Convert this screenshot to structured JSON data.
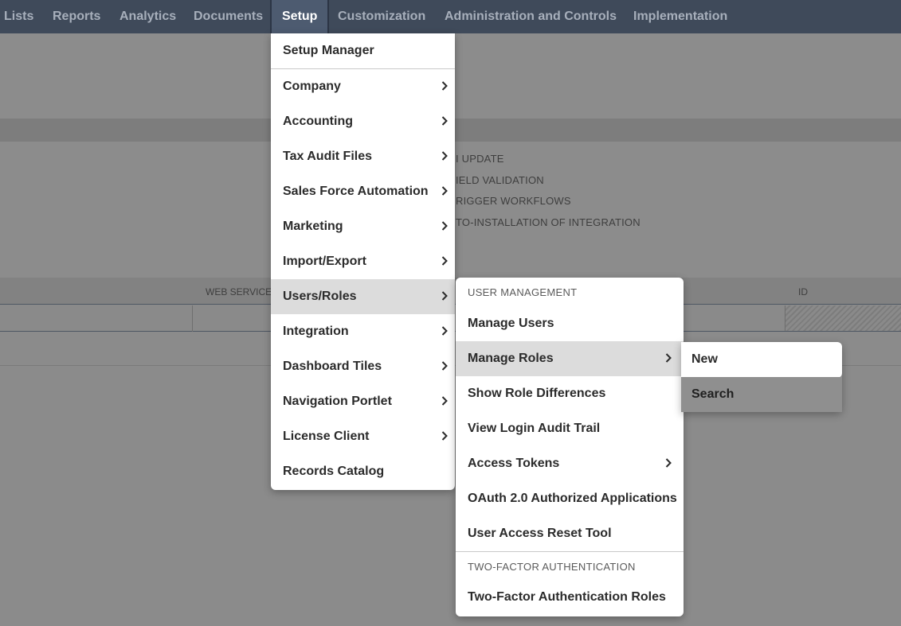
{
  "topnav": {
    "items": [
      "Lists",
      "Reports",
      "Analytics",
      "Documents",
      "Setup",
      "Customization",
      "Administration and Controls",
      "Implementation"
    ],
    "active": "Setup"
  },
  "background": {
    "lines": [
      "I UPDATE",
      "IELD VALIDATION",
      "RIGGER WORKFLOWS",
      "TO-INSTALLATION OF INTEGRATION"
    ],
    "table_headers": [
      "WEB SERVICES",
      "ID"
    ]
  },
  "setup_menu": {
    "items": [
      {
        "label": "Setup Manager",
        "submenu": false
      },
      {
        "label": "Company",
        "submenu": true
      },
      {
        "label": "Accounting",
        "submenu": true
      },
      {
        "label": "Tax Audit Files",
        "submenu": true
      },
      {
        "label": "Sales Force Automation",
        "submenu": true
      },
      {
        "label": "Marketing",
        "submenu": true
      },
      {
        "label": "Import/Export",
        "submenu": true
      },
      {
        "label": "Users/Roles",
        "submenu": true,
        "highlighted": true
      },
      {
        "label": "Integration",
        "submenu": true
      },
      {
        "label": "Dashboard Tiles",
        "submenu": true
      },
      {
        "label": "Navigation Portlet",
        "submenu": true
      },
      {
        "label": "License Client",
        "submenu": true
      },
      {
        "label": "Records Catalog",
        "submenu": false
      }
    ]
  },
  "users_roles_menu": {
    "section1_header": "USER MANAGEMENT",
    "items": [
      {
        "label": "Manage Users",
        "submenu": false
      },
      {
        "label": "Manage Roles",
        "submenu": true,
        "highlighted": true
      },
      {
        "label": "Show Role Differences",
        "submenu": false
      },
      {
        "label": "View Login Audit Trail",
        "submenu": false
      },
      {
        "label": "Access Tokens",
        "submenu": true
      },
      {
        "label": "OAuth 2.0 Authorized Applications",
        "submenu": false
      },
      {
        "label": "User Access Reset Tool",
        "submenu": false
      }
    ],
    "section2_header": "TWO-FACTOR AUTHENTICATION",
    "items2": [
      {
        "label": "Two-Factor Authentication Roles",
        "submenu": false
      }
    ]
  },
  "manage_roles_menu": {
    "items": [
      {
        "label": "New"
      },
      {
        "label": "Search"
      }
    ]
  },
  "colors": {
    "nav_bg": "#3f4a5a",
    "nav_active_bg": "#4d5b70",
    "overlay_bg": "#8b8b8b",
    "menu_bg": "#ffffff",
    "menu_highlight": "#dcdcdc"
  },
  "icons": {
    "submenu_indicator": "chevron-right-icon"
  }
}
